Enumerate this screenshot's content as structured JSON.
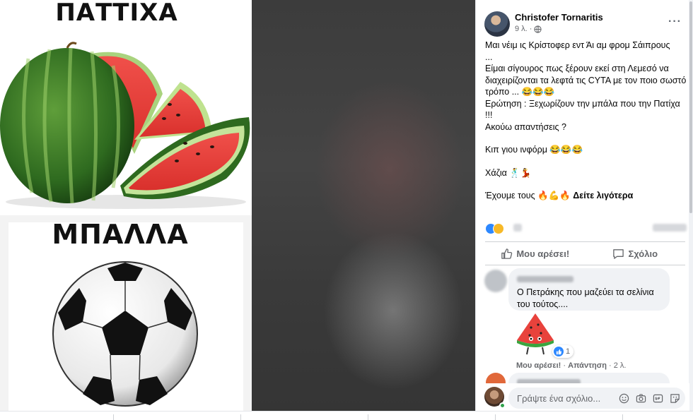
{
  "image_labels": {
    "top_word": "ΠΑΤΤΙΧΑ",
    "bottom_word": "ΜΠΑΛΛΑ"
  },
  "post": {
    "author": "Christofer Tornaritis",
    "time": "9 λ. ·",
    "more_label": "···",
    "lines": [
      "Μαι νέιμ ις Κρίστοφερ εντ Άι αμ φρομ Σάιπρους",
      "...",
      "Είμαι σίγουρος πως ξέρουν εκεί στη Λεμεσό να διαχειρίζονται τα λεφτά τις CYTA με τον ποιο σωστό τρόπο ... 😂😂😂",
      "Ερώτηση : Ξεχωρίζουν την μπάλα που την Πατίχα !!!",
      "Ακούω απαντήσεις ?",
      "Κιπ γιου ινφόρμ 😂😂😂",
      "Χάζια 🕺💃",
      "Έχουμε τους 🔥💪🔥"
    ],
    "see_more": "Δείτε λιγότερα"
  },
  "actions": {
    "like": "Μου αρέσει!",
    "comment": "Σχόλιο"
  },
  "comment": {
    "text": "Ο Πετράκης που μαζεύει τα σελίνια του τούτος....",
    "reaction_count": "1",
    "like": "Μου αρέσει!",
    "reply": "Απάντηση",
    "time": "· 2 λ."
  },
  "composer": {
    "placeholder": "Γράψτε ένα σχόλιο..."
  },
  "colors": {
    "like_blue": "#2d88ff",
    "haha_yellow": "#f7b928",
    "bubble_gray": "#f0f2f5",
    "secondary_text": "#65676b"
  },
  "icons": [
    "globe-icon",
    "more-icon",
    "like-icon",
    "comment-icon",
    "emoji-icon",
    "camera-icon",
    "gif-icon",
    "sticker-icon"
  ]
}
